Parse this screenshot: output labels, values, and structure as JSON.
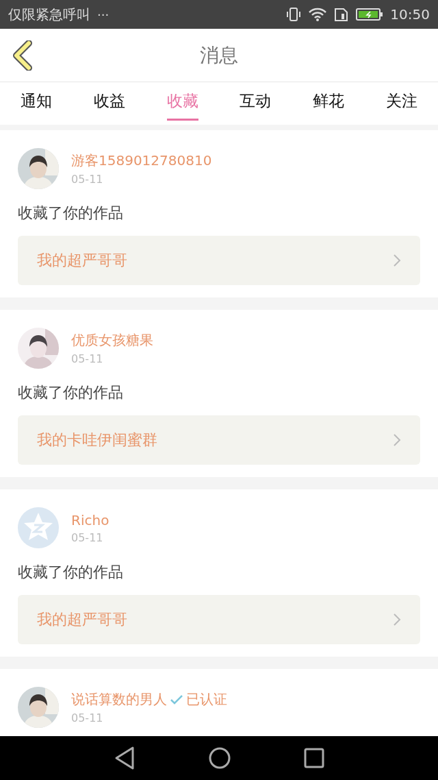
{
  "status_bar": {
    "carrier": "仅限紧急呼叫",
    "more": "···",
    "time": "10:50"
  },
  "header": {
    "title": "消息"
  },
  "tabs": [
    {
      "label": "通知",
      "selected": false
    },
    {
      "label": "收益",
      "selected": false
    },
    {
      "label": "收藏",
      "selected": true
    },
    {
      "label": "互动",
      "selected": false
    },
    {
      "label": "鲜花",
      "selected": false
    },
    {
      "label": "关注",
      "selected": false
    }
  ],
  "messages": [
    {
      "name": "游客1589012780810",
      "verified": false,
      "date": "05-11",
      "action": "收藏了你的作品",
      "work": "我的超严哥哥"
    },
    {
      "name": "优质女孩糖果",
      "verified": false,
      "date": "05-11",
      "action": "收藏了你的作品",
      "work": "我的卡哇伊闺蜜群"
    },
    {
      "avatar": {
        "kind": "default"
      },
      "name": "Richo",
      "verified": false,
      "date": "05-11",
      "action": "收藏了你的作品",
      "work": "我的超严哥哥"
    },
    {
      "name": "说话算数的男人",
      "verified": true,
      "verified_label": "已认证",
      "date": "05-11"
    }
  ]
}
